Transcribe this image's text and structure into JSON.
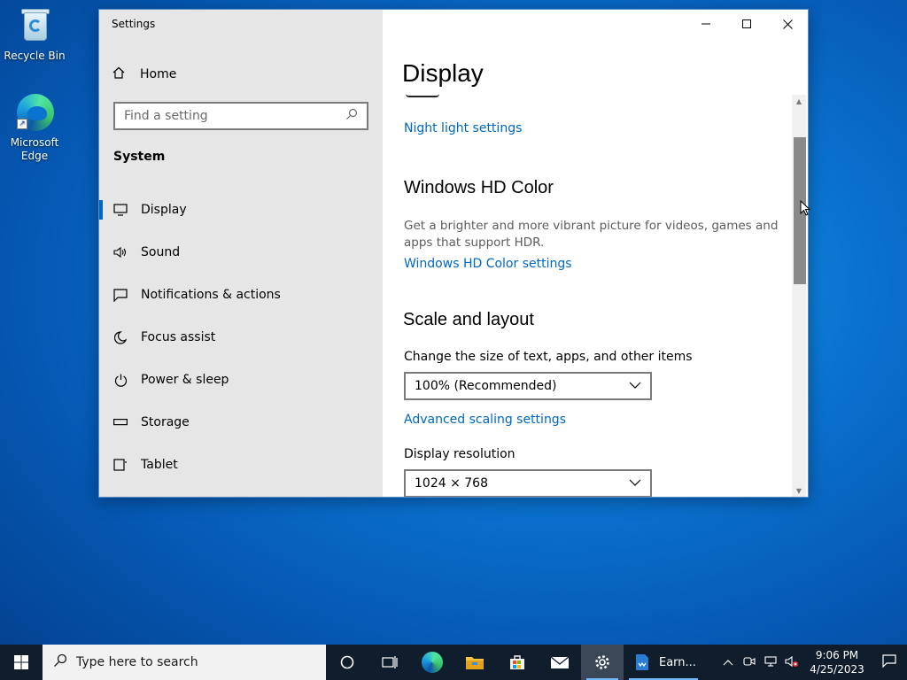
{
  "desktop": {
    "icons": [
      {
        "label": "Recycle Bin",
        "icon": "recycle-bin-icon"
      },
      {
        "label": "Microsoft Edge",
        "icon": "edge-icon"
      }
    ]
  },
  "window": {
    "title": "Settings",
    "caption": {
      "minimize": "—",
      "maximize": "☐",
      "close": "✕"
    }
  },
  "sidebar": {
    "home_label": "Home",
    "search_placeholder": "Find a setting",
    "section_label": "System",
    "items": [
      {
        "label": "Display",
        "icon": "monitor-icon",
        "active": true
      },
      {
        "label": "Sound",
        "icon": "speaker-icon"
      },
      {
        "label": "Notifications & actions",
        "icon": "notification-icon"
      },
      {
        "label": "Focus assist",
        "icon": "moon-icon"
      },
      {
        "label": "Power & sleep",
        "icon": "power-icon"
      },
      {
        "label": "Storage",
        "icon": "storage-icon"
      },
      {
        "label": "Tablet",
        "icon": "tablet-icon"
      }
    ]
  },
  "content": {
    "page_title": "Display",
    "night_light_link": "Night light settings",
    "hd_color": {
      "heading": "Windows HD Color",
      "description": "Get a brighter and more vibrant picture for videos, games and apps that support HDR.",
      "link": "Windows HD Color settings"
    },
    "scale_layout": {
      "heading": "Scale and layout",
      "size_label": "Change the size of text, apps, and other items",
      "size_value": "100% (Recommended)",
      "advanced_link": "Advanced scaling settings",
      "resolution_label": "Display resolution",
      "resolution_value": "1024 × 768"
    }
  },
  "taskbar": {
    "search_placeholder": "Type here to search",
    "apps": [
      {
        "icon": "cortana-icon"
      },
      {
        "icon": "task-view-icon"
      },
      {
        "icon": "edge-icon"
      },
      {
        "icon": "file-explorer-icon"
      },
      {
        "icon": "store-icon"
      },
      {
        "icon": "mail-icon"
      },
      {
        "icon": "settings-icon",
        "active": true
      }
    ],
    "open_doc_label": "Earn...",
    "tray": {
      "time": "9:06 PM",
      "date": "4/25/2023"
    }
  }
}
